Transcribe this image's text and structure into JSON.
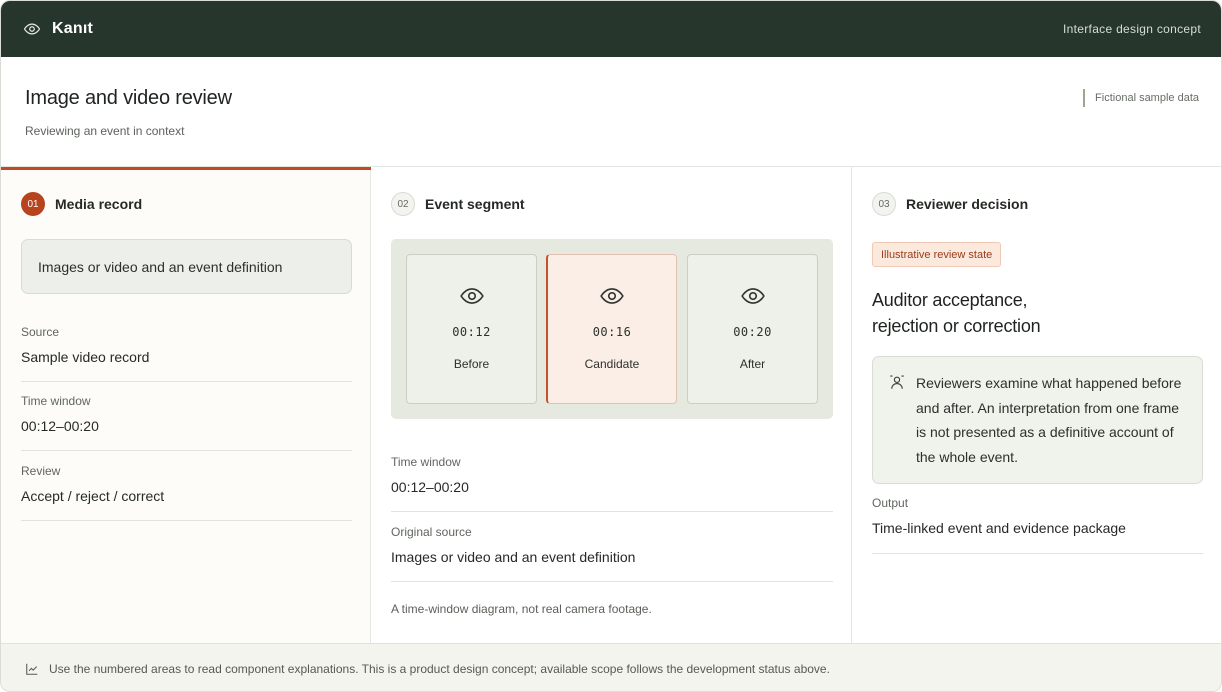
{
  "topbar": {
    "brand": "Kanıt",
    "right_text": "Interface design concept"
  },
  "header": {
    "title": "Image and video review",
    "subtitle": "Reviewing an event in context",
    "sample_note": "Fictional sample data"
  },
  "media_record": {
    "number": "01",
    "title": "Media record",
    "info": "Images or video and an event definition",
    "fields": [
      {
        "label": "Source",
        "value": "Sample video record"
      },
      {
        "label": "Time window",
        "value": "00:12–00:20"
      },
      {
        "label": "Review",
        "value": "Accept / reject / correct"
      }
    ]
  },
  "event_segment": {
    "number": "02",
    "title": "Event segment",
    "frames": [
      {
        "time": "00:12",
        "label": "Before"
      },
      {
        "time": "00:16",
        "label": "Candidate"
      },
      {
        "time": "00:20",
        "label": "After"
      }
    ],
    "fields": [
      {
        "label": "Time window",
        "value": "00:12–00:20"
      },
      {
        "label": "Original source",
        "value": "Images or video and an event definition"
      }
    ],
    "note": "A time-window diagram, not real camera footage."
  },
  "reviewer_decision": {
    "number": "03",
    "title": "Reviewer decision",
    "tag": "Illustrative review state",
    "heading_line1": "Auditor acceptance,",
    "heading_line2": "rejection or correction",
    "explanation": "Reviewers examine what happened before and after. An interpretation from one frame is not presented as a definitive account of the whole event.",
    "output_label": "Output",
    "output_value": "Time-linked event and evidence package"
  },
  "footer": {
    "text": "Use the numbered areas to read component explanations. This is a product design concept; available scope follows the development status above."
  },
  "colors": {
    "topbar": "#27362c",
    "accent": "#c04a26",
    "panel": "#e5e9df"
  },
  "icons": {
    "brand": "eye-icon",
    "frame": "eye-icon",
    "reviewer": "reviewer-icon",
    "footer": "chart-icon"
  }
}
